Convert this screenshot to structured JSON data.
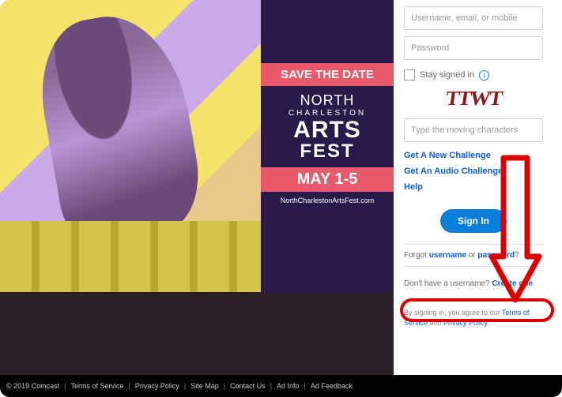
{
  "banner": {
    "save": "SAVE THE DATE",
    "north": "NORTH",
    "charleston": "CHARLESTON",
    "arts": "ARTS",
    "fest": "FEST",
    "dates": "MAY 1-5",
    "url": "NorthCharlestonArtsFest.com"
  },
  "login": {
    "username_ph": "Username, email, or mobile",
    "password_ph": "Password",
    "stay": "Stay signed in",
    "captcha_sample": "TTWT",
    "captcha_ph": "Type the moving characters",
    "new_challenge": "Get A New Challenge",
    "audio_challenge": "Get An Audio Challenge",
    "help": "Help",
    "signin": "Sign In",
    "forgot_prefix": "Forgot ",
    "forgot_user": "username",
    "forgot_or": " or ",
    "forgot_pass": "password",
    "forgot_q": "?",
    "create_prefix": "Don't have a username? ",
    "create_link": "Create one",
    "agree_prefix": "By signing in, you agree to our ",
    "tos": "Terms of Service",
    "and": " and ",
    "privacy": "Privacy Policy",
    "period": "."
  },
  "footer": {
    "copyright": "© 2019 Comcast",
    "tos": "Terms of Service",
    "privacy": "Privacy Policy",
    "sitemap": "Site Map",
    "contact": "Contact Us",
    "adinfo": "Ad Info",
    "adfeedback": "Ad Feedback"
  }
}
